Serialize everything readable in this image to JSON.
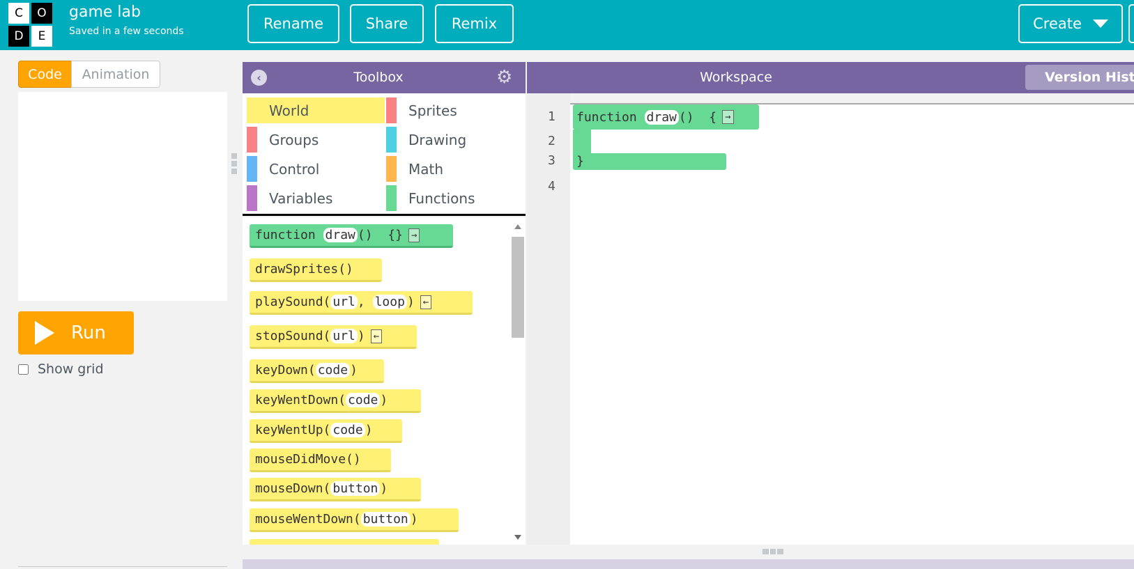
{
  "header": {
    "logo_letters": [
      "C",
      "O",
      "D",
      "E"
    ],
    "app_title": "game lab",
    "save_status": "Saved in a few seconds",
    "rename_label": "Rename",
    "share_label": "Share",
    "remix_label": "Remix",
    "create_label": "Create",
    "bg_color": "#00adbc"
  },
  "left_panel": {
    "tabs": [
      {
        "label": "Code",
        "active": true
      },
      {
        "label": "Animation",
        "active": false
      }
    ],
    "run_label": "Run",
    "show_grid_label": "Show grid",
    "accent_color": "#ffa400"
  },
  "toolbox": {
    "title": "Toolbox",
    "categories": [
      {
        "label": "World",
        "color": "#fff176"
      },
      {
        "label": "Sprites",
        "color": "#f78183"
      },
      {
        "label": "Groups",
        "color": "#f78183"
      },
      {
        "label": "Drawing",
        "color": "#4dd0e1"
      },
      {
        "label": "Control",
        "color": "#64b5f6"
      },
      {
        "label": "Math",
        "color": "#ffb74d"
      },
      {
        "label": "Variables",
        "color": "#bb77c7"
      },
      {
        "label": "Functions",
        "color": "#68d995"
      }
    ],
    "blocks": [
      {
        "name": "function",
        "arg": "draw",
        "suffix": "()  {}"
      },
      {
        "name": "drawSprites()"
      },
      {
        "name": "playSound(",
        "arg1": "url",
        "sep": ",",
        "arg2": "loop",
        "close": ")"
      },
      {
        "name": "stopSound(",
        "arg1": "url",
        "close": ")"
      },
      {
        "name": "keyDown(",
        "arg1": "code",
        "close": ")"
      },
      {
        "name": "keyWentDown(",
        "arg1": "code",
        "close": ")"
      },
      {
        "name": "keyWentUp(",
        "arg1": "code",
        "close": ")"
      },
      {
        "name": "mouseDidMove()"
      },
      {
        "name": "mouseDown(",
        "arg1": "button",
        "close": ")"
      },
      {
        "name": "mouseWentDown(",
        "arg1": "button",
        "close": ")"
      }
    ],
    "arrow_right": "→",
    "arrow_left": "←",
    "header_color": "#7665a0"
  },
  "workspace": {
    "title": "Workspace",
    "version_history_label": "Version History",
    "line_numbers": [
      "1",
      "2",
      "3",
      "4"
    ],
    "code_keyword": "function",
    "code_name": "draw",
    "code_suffix": "()  {",
    "code_close": "}"
  }
}
